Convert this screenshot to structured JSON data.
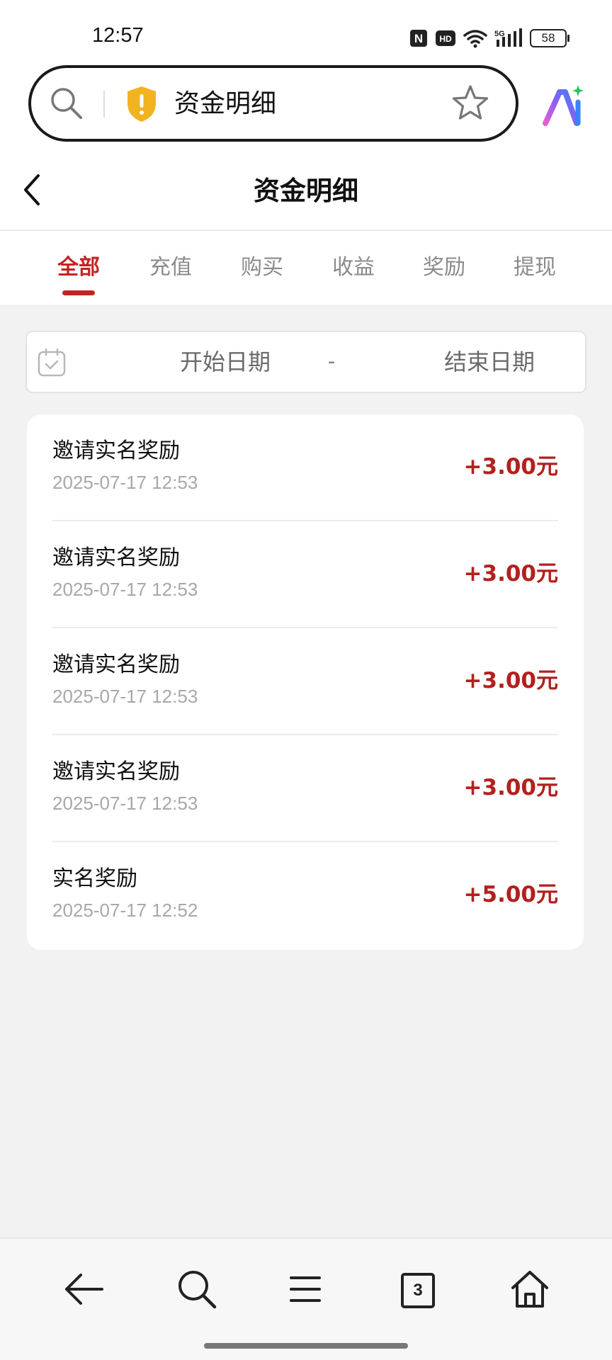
{
  "status_bar": {
    "time": "12:57",
    "network": "5G",
    "hd_label": "HD",
    "nfc_label": "N",
    "battery": "58"
  },
  "browser": {
    "address_text": "资金明细"
  },
  "header": {
    "title": "资金明细"
  },
  "tabs": [
    {
      "label": "全部",
      "active": true
    },
    {
      "label": "充值",
      "active": false
    },
    {
      "label": "购买",
      "active": false
    },
    {
      "label": "收益",
      "active": false
    },
    {
      "label": "奖励",
      "active": false
    },
    {
      "label": "提现",
      "active": false
    }
  ],
  "date_filter": {
    "start_placeholder": "开始日期",
    "separator": "-",
    "end_placeholder": "结束日期"
  },
  "transactions": [
    {
      "title": "邀请实名奖励",
      "time": "2025-07-17 12:53",
      "amount": "+3.00元"
    },
    {
      "title": "邀请实名奖励",
      "time": "2025-07-17 12:53",
      "amount": "+3.00元"
    },
    {
      "title": "邀请实名奖励",
      "time": "2025-07-17 12:53",
      "amount": "+3.00元"
    },
    {
      "title": "邀请实名奖励",
      "time": "2025-07-17 12:53",
      "amount": "+3.00元"
    },
    {
      "title": "实名奖励",
      "time": "2025-07-17 12:52",
      "amount": "+5.00元"
    }
  ],
  "bottom_nav": {
    "tab_count": "3"
  },
  "colors": {
    "accent": "#c42323",
    "amount": "#b3201d",
    "background": "#f2f2f2"
  }
}
